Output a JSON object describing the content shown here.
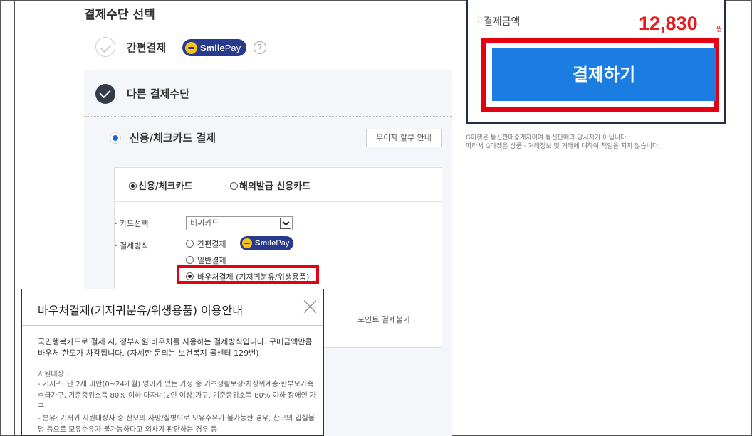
{
  "payment_section": {
    "title": "결제수단 선택",
    "easy_pay_label": "간편결제",
    "smilepay_brand_bold": "Smile",
    "smilepay_brand_light": "Pay",
    "help_icon": "?",
    "other_label": "다른 결제수단",
    "card_title": "신용/체크카드 결제",
    "installment_button": "무이자 할부 안내",
    "card_types": [
      "신용/체크카드",
      "해외발급 신용카드"
    ],
    "card_select_label": "· 카드선택",
    "card_select_value": "비씨카드",
    "method_label": "· 결제방식",
    "method_options": [
      "간편결제",
      "일반결제",
      "바우처결제 (기저귀분유/위생용품)"
    ],
    "point_note": "포인트 결제불가"
  },
  "popup": {
    "title": "바우처결제(기저귀분유/위생용품) 이용안내",
    "description": "국민행복카드로 결제 시, 정부지원 바우처를 사용하는 결제방식입니다. 구매금액만큼 바우처 한도가 차감됩니다. (자세한 문의는 보건복지 콜센터 129번)",
    "support_title": "지원대상 :",
    "support_lines": [
      "- 기저귀: 만 2세 미만(0~24개월) 영아가 있는 가정 중 기초생활보장·차상위계층·한부모가족 수급가구, 기준중위소득 80% 이하 다자녀(2인 이상)가구, 기준중위소득 80% 이하 장애인 가구",
      "- 분유: 기저귀 지원대상자 중 산모의 사망/질병으로 모유수유가 불가능한 경우, 산모의 입실불명 등으로 모유수유가 불가능하다고 의사가 판단하는 경우 등"
    ]
  },
  "summary": {
    "amount_label": "· 결제금액",
    "amount": "12,830",
    "amount_unit": "원",
    "pay_button": "결제하기",
    "notice_lines": [
      "G마켓은 통신판매중개자이며 통신판매의 당사자가 아닙니다.",
      "따라서 G마켓은 상품 · 거래정보 및 거래에 대하여 책임을 지지 않습니다."
    ]
  },
  "colors": {
    "accent_blue": "#1b7de2",
    "price_red": "#e8181b",
    "highlight_red": "#e60012",
    "smilepay_navy": "#273a8c"
  }
}
